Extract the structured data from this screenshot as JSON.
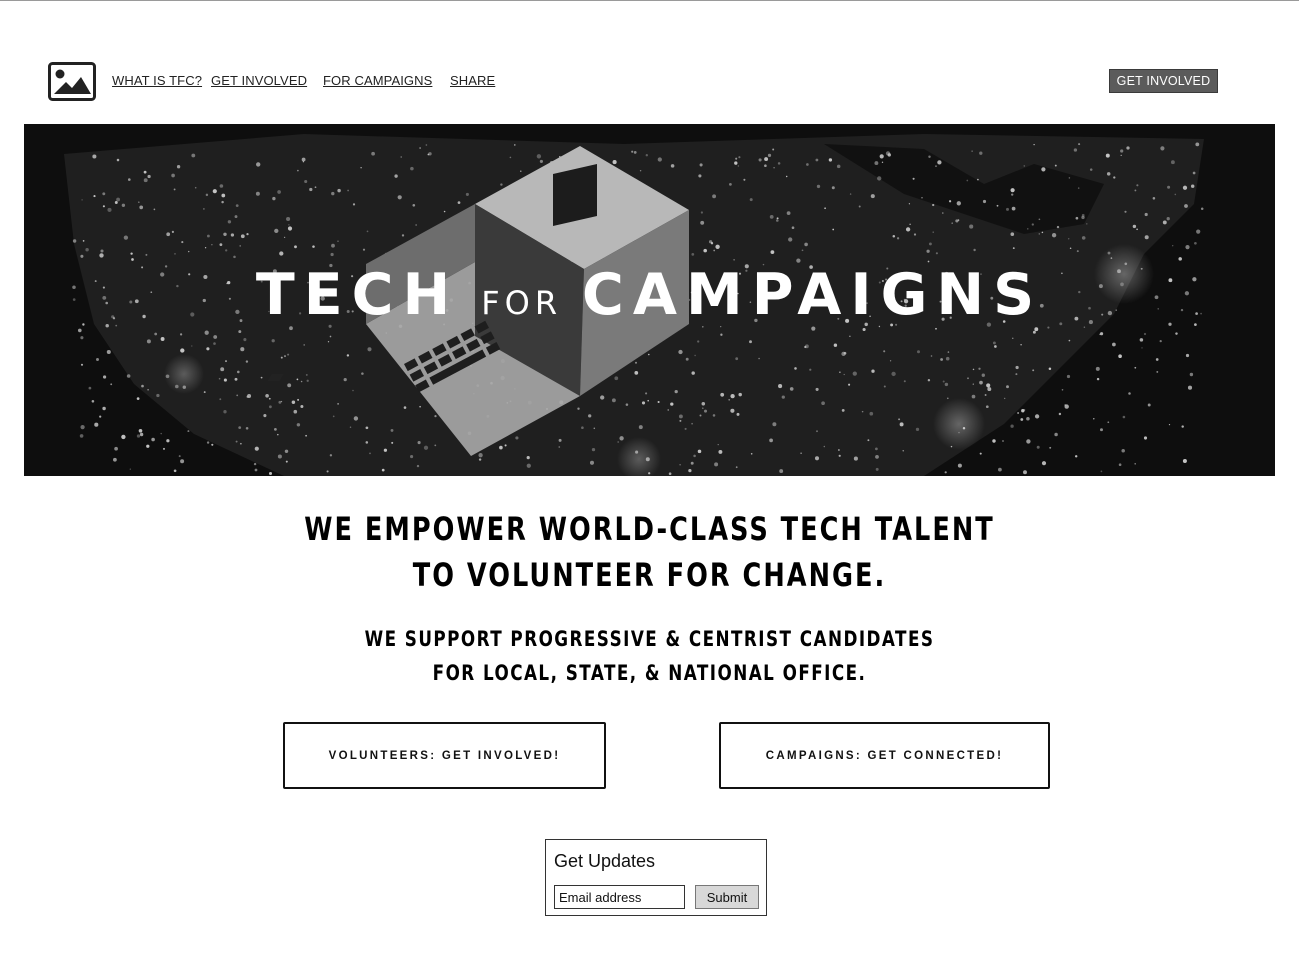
{
  "nav": {
    "logo_icon": "image-placeholder-icon",
    "links": [
      {
        "label": "WHAT IS TFC?"
      },
      {
        "label": "GET INVOLVED"
      },
      {
        "label": "FOR CAMPAIGNS"
      },
      {
        "label": "SHARE"
      }
    ],
    "cta_label": "GET INVOLVED"
  },
  "hero": {
    "title_part1": "TECH",
    "title_part2": "FOR",
    "title_part3": "CAMPAIGNS"
  },
  "headline": {
    "line1": "WE EMPOWER WORLD-CLASS TECH TALENT",
    "line2": "TO VOLUNTEER FOR CHANGE."
  },
  "subheadline": {
    "line1": "WE SUPPORT PROGRESSIVE & CENTRIST CANDIDATES",
    "line2": "FOR LOCAL, STATE, & NATIONAL OFFICE."
  },
  "buttons": {
    "volunteers": "VOLUNTEERS: GET INVOLVED!",
    "campaigns": "CAMPAIGNS: GET CONNECTED!"
  },
  "updates": {
    "title": "Get Updates",
    "email_placeholder": "Email address",
    "submit_label": "Submit"
  }
}
